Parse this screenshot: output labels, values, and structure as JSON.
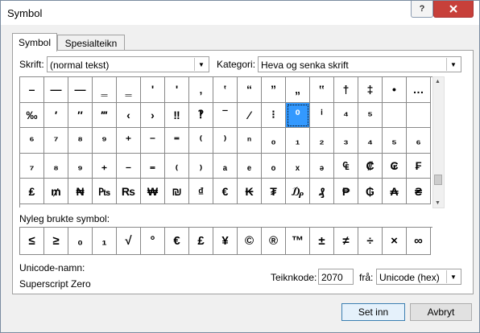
{
  "window": {
    "title": "Symbol",
    "help": "?",
    "close": "X"
  },
  "tabs": [
    "Symbol",
    "Spesialteikn"
  ],
  "font": {
    "label": "Skrift:",
    "value": "(normal tekst)"
  },
  "subset": {
    "label": "Kategori:",
    "value": "Heva og senka skrift"
  },
  "grid_rows": [
    [
      "–",
      "—",
      "―",
      "‗",
      "‗",
      "'",
      "'",
      "‚",
      "‛",
      "“",
      "”",
      "„",
      "‟",
      "†",
      "‡",
      "•",
      "…"
    ],
    [
      "‰",
      "′",
      "″",
      "‴",
      "‹",
      "›",
      "‼",
      "‽",
      "‾",
      "⁄",
      "⁝",
      "⁰",
      "ⁱ",
      "⁴",
      "⁵",
      "",
      ""
    ],
    [
      "⁶",
      "⁷",
      "⁸",
      "⁹",
      "⁺",
      "⁻",
      "⁼",
      "⁽",
      "⁾",
      "ⁿ",
      "₀",
      "₁",
      "₂",
      "₃",
      "₄",
      "₅",
      "₆"
    ],
    [
      "₇",
      "₈",
      "₉",
      "₊",
      "₋",
      "₌",
      "₍",
      "₎",
      "ₐ",
      "ₑ",
      "ₒ",
      "ₓ",
      "ₔ",
      "₠",
      "₡",
      "₢",
      "₣"
    ],
    [
      "₤",
      "₥",
      "₦",
      "₧",
      "₨",
      "₩",
      "₪",
      "₫",
      "€",
      "₭",
      "₮",
      "₯",
      "₰",
      "₱",
      "₲",
      "₳",
      "₴"
    ]
  ],
  "selected": {
    "row": 1,
    "col": 11
  },
  "recent": {
    "label": "Nyleg brukte symbol:",
    "symbols": [
      "≤",
      "≥",
      "₀",
      "₁",
      "√",
      "°",
      "€",
      "£",
      "¥",
      "©",
      "®",
      "™",
      "±",
      "≠",
      "÷",
      "×",
      "∞"
    ]
  },
  "unicode_name": {
    "label": "Unicode-namn:",
    "value": "Superscript Zero"
  },
  "char_code": {
    "label": "Teiknkode:",
    "value": "2070"
  },
  "from": {
    "label": "frå:",
    "value": "Unicode (hex)"
  },
  "buttons": {
    "insert": "Set inn",
    "cancel": "Avbryt"
  }
}
